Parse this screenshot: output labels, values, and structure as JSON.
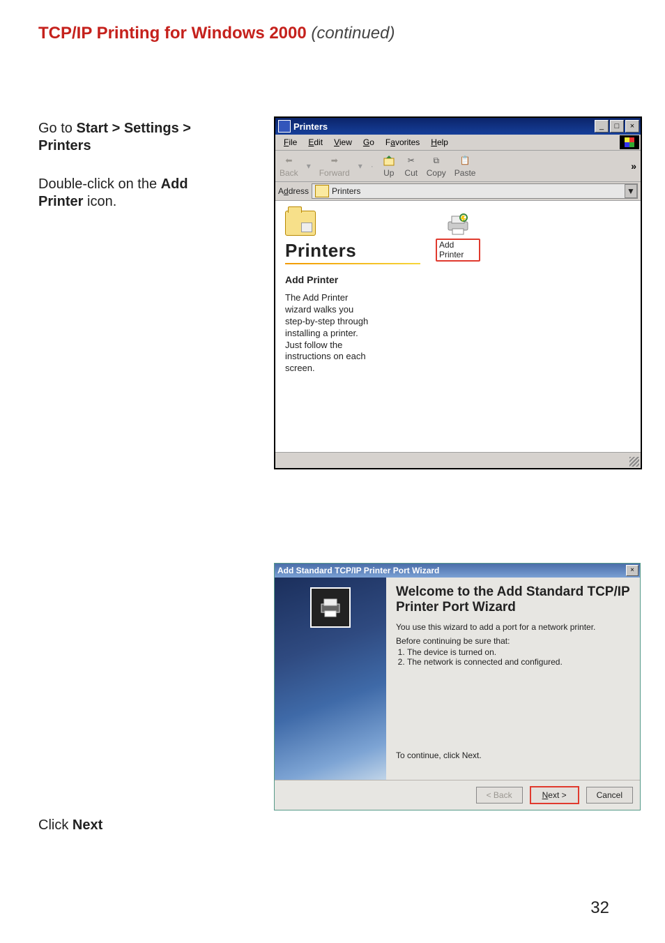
{
  "page": {
    "headline_red": "TCP/IP Printing for Windows 2000",
    "headline_em": " (continued)",
    "number": "32",
    "step1_pre": "Go to ",
    "step1_bold": "Start > Settings > Printers",
    "step2_pre": "Double-click on the ",
    "step2_bold": "Add Printer",
    "step2_post": "  icon.",
    "step3_pre": "Click ",
    "step3_bold": "Next"
  },
  "printers_window": {
    "title": "Printers",
    "menus": {
      "file": "File",
      "edit": "Edit",
      "view": "View",
      "go": "Go",
      "favorites": "Favorites",
      "help": "Help"
    },
    "toolbar": {
      "back": "Back",
      "forward": "Forward",
      "up": "Up",
      "cut": "Cut",
      "copy": "Copy",
      "paste": "Paste"
    },
    "address_label": "Address",
    "address_value": "Printers",
    "folder_title": "Printers",
    "section_title": "Add Printer",
    "help_text": "The Add Printer wizard walks you step-by-step through installing a printer. Just follow the instructions on each screen.",
    "add_printer_label": "Add Printer"
  },
  "wizard": {
    "title": "Add Standard TCP/IP Printer Port Wizard",
    "heading": "Welcome to the Add Standard TCP/IP Printer Port Wizard",
    "intro_line": "You use this wizard to add a port for a network printer.",
    "before_line": "Before continuing be sure that:",
    "li1": "The device is turned on.",
    "li2": "The network is connected and configured.",
    "continue_line": "To continue, click Next.",
    "btn_back": "< Back",
    "btn_next": "Next >",
    "btn_cancel": "Cancel"
  }
}
